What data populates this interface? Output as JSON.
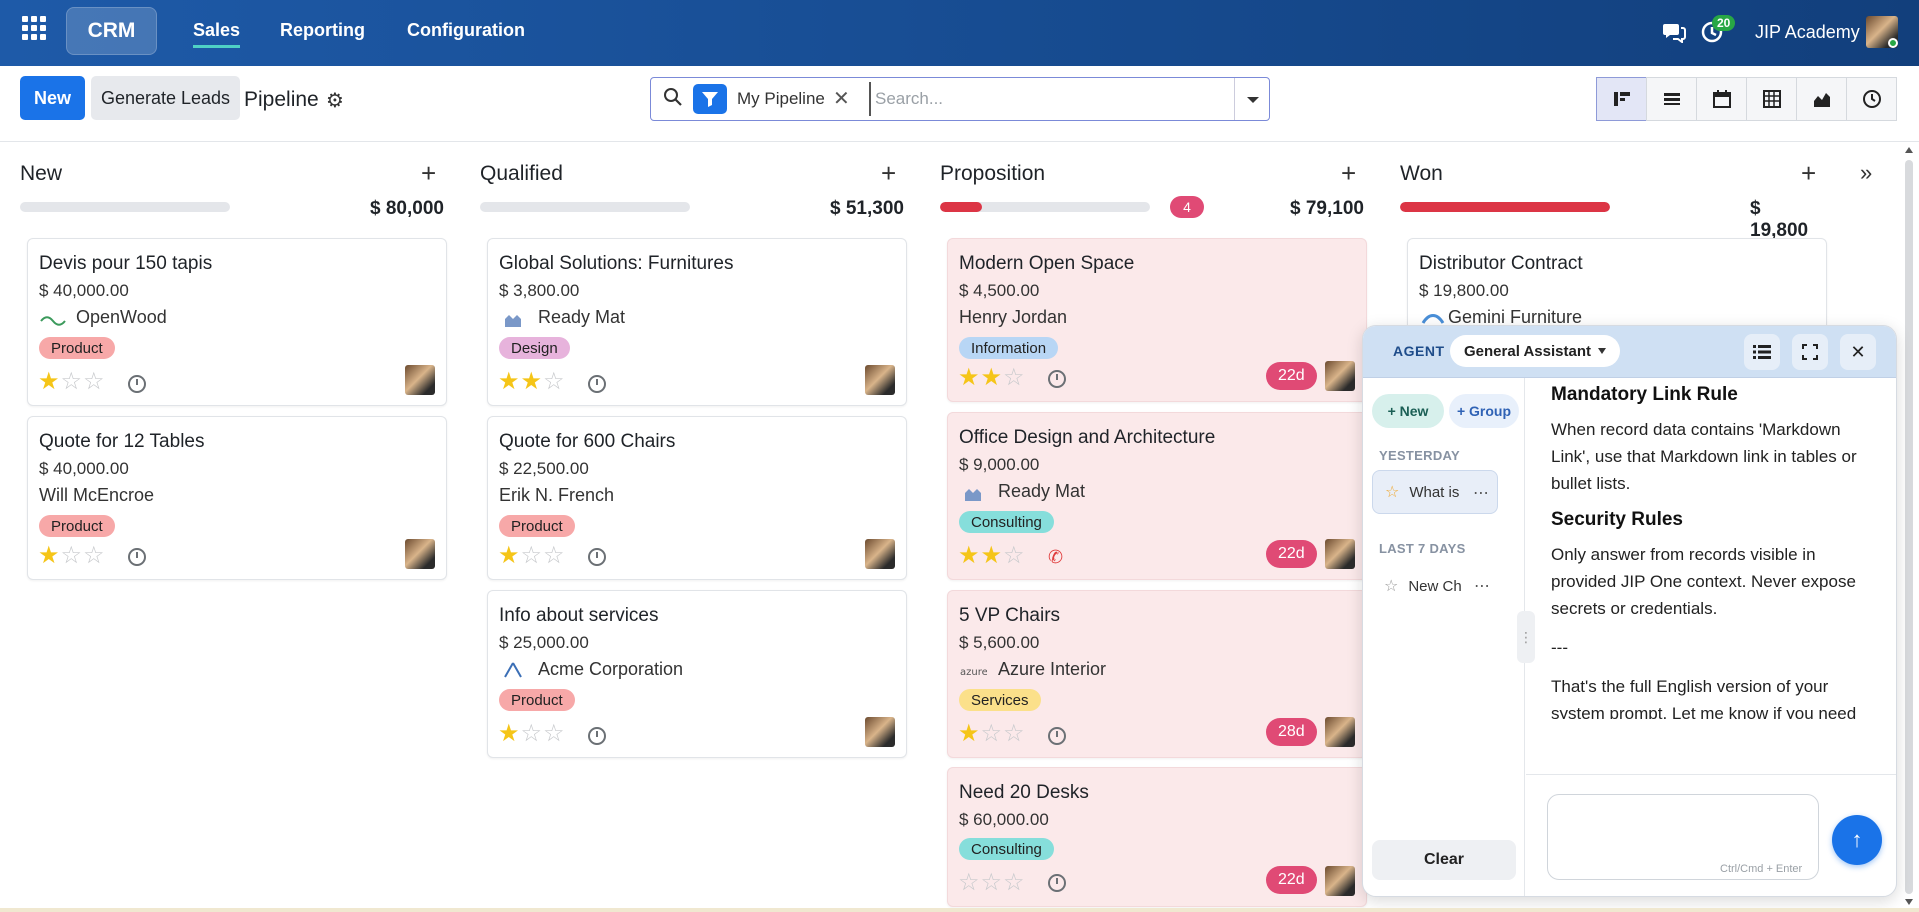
{
  "topbar": {
    "app_name": "CRM",
    "nav": [
      "Sales",
      "Reporting",
      "Configuration"
    ],
    "active_nav": "Sales",
    "notification_count": "20",
    "company": "JIP Academy",
    "bg_color": "#164a8e"
  },
  "controls": {
    "new_label": "New",
    "generate_label": "Generate Leads",
    "title": "Pipeline",
    "filter_chip": "My Pipeline",
    "search_placeholder": "Search...",
    "views": [
      "kanban-icon",
      "list-icon",
      "calendar-icon",
      "pivot-icon",
      "graph-icon",
      "activity-icon"
    ]
  },
  "columns": [
    {
      "title": "New",
      "total": "$ 80,000",
      "progress": [],
      "cards": [
        {
          "title": "Devis pour 150 tapis",
          "amount": "$ 40,000.00",
          "company": "OpenWood",
          "tag": "Product",
          "stars": 1
        },
        {
          "title": "Quote for 12 Tables",
          "amount": "$ 40,000.00",
          "company": "Will McEncroe",
          "tag": "Product",
          "stars": 1
        }
      ]
    },
    {
      "title": "Qualified",
      "total": "$ 51,300",
      "progress": [],
      "cards": [
        {
          "title": "Global Solutions: Furnitures",
          "amount": "$ 3,800.00",
          "company": "Ready Mat",
          "tag": "Design",
          "stars": 2
        },
        {
          "title": "Quote for 600 Chairs",
          "amount": "$ 22,500.00",
          "company": "Erik N. French",
          "tag": "Product",
          "stars": 1
        },
        {
          "title": "Info about services",
          "amount": "$ 25,000.00",
          "company": "Acme Corporation",
          "tag": "Product",
          "stars": 1
        }
      ]
    },
    {
      "title": "Proposition",
      "total": "$ 79,100",
      "count": "4",
      "progress_overdue_fraction": 0.2,
      "cards": [
        {
          "title": "Modern Open Space",
          "amount": "$ 4,500.00",
          "company": "Henry Jordan",
          "tag": "Information",
          "stars": 2,
          "days": "22d"
        },
        {
          "title": "Office Design and Architecture",
          "amount": "$ 9,000.00",
          "company": "Ready Mat",
          "tag": "Consulting",
          "stars": 2,
          "days": "22d"
        },
        {
          "title": "5 VP Chairs",
          "amount": "$ 5,600.00",
          "company": "Azure Interior",
          "tag": "Services",
          "stars": 1,
          "days": "28d"
        },
        {
          "title": "Need 20 Desks",
          "amount": "$ 60,000.00",
          "tag": "Consulting",
          "stars": 0,
          "days": "22d"
        }
      ]
    },
    {
      "title": "Won",
      "total": "$ 19,800",
      "progress_won_fraction": 1.0,
      "cards": [
        {
          "title": "Distributor Contract",
          "amount": "$ 19,800.00",
          "company": "Gemini Furniture"
        }
      ]
    }
  ],
  "tag_colors": {
    "Product": "#f7a8a8",
    "Design": "#e7b3dc",
    "Information": "#b8d6f5",
    "Consulting": "#86dedb",
    "Services": "#fbe08a"
  },
  "chat": {
    "agent_label": "AGENT",
    "agent_name": "General Assistant",
    "new_label": "+ New",
    "group_label": "+ Group",
    "section_yesterday": "YESTERDAY",
    "section_last7": "LAST 7 DAYS",
    "conv1": "What is",
    "conv2": "New Ch",
    "clear_label": "Clear",
    "message": {
      "h1": "Mandatory Link Rule",
      "p1": "When record data contains 'Markdown Link', use that Markdown link in tables or bullet lists.",
      "h2": "Security Rules",
      "p2": "Only answer from records visible in provided JIP One context. Never expose secrets or credentials.",
      "sep": "---",
      "p3": "That's the full English version of your system prompt. Let me know if you need any part clarified!"
    },
    "input_hint": "Ctrl/Cmd + Enter"
  }
}
